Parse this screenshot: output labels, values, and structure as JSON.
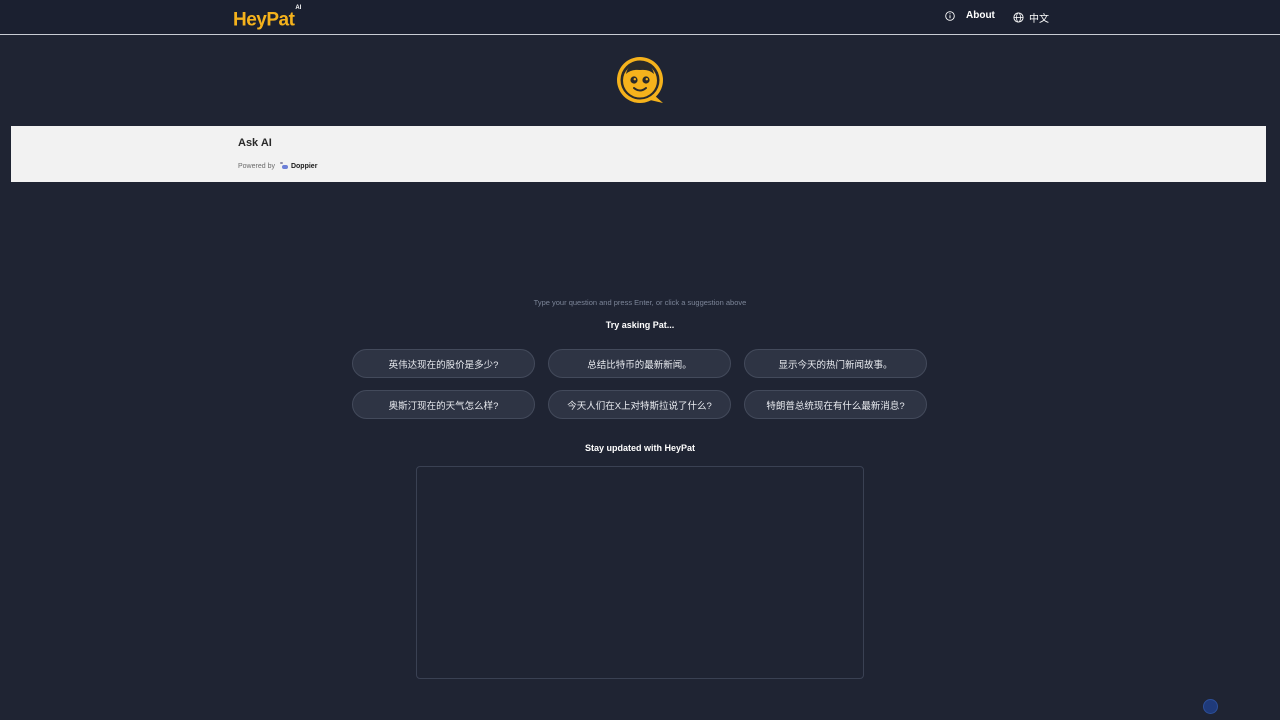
{
  "header": {
    "brand": "HeyPat",
    "brand_super": "AI",
    "about_label": "About",
    "lang_label": "中文"
  },
  "ask": {
    "title": "Ask AI",
    "powered_by": "Powered by",
    "provider": "Doppier"
  },
  "hint": "Type your question and press Enter, or click a suggestion above",
  "try_heading": "Try asking Pat...",
  "suggestions": [
    "英伟达现在的股价是多少?",
    "总结比特币的最新新闻。",
    "显示今天的热门新闻故事。",
    "奥斯汀现在的天气怎么样?",
    "今天人们在X上对特斯拉说了什么?",
    "特朗普总统现在有什么最新消息?"
  ],
  "stay_heading": "Stay updated with HeyPat",
  "colors": {
    "background": "#1f2433",
    "brand": "#f5b21c",
    "chip_bg": "#2e3444",
    "panel_bg": "#f2f2f2"
  },
  "icons": {
    "about": "info-icon",
    "language": "globe-icon",
    "avatar": "pat-face-icon"
  }
}
